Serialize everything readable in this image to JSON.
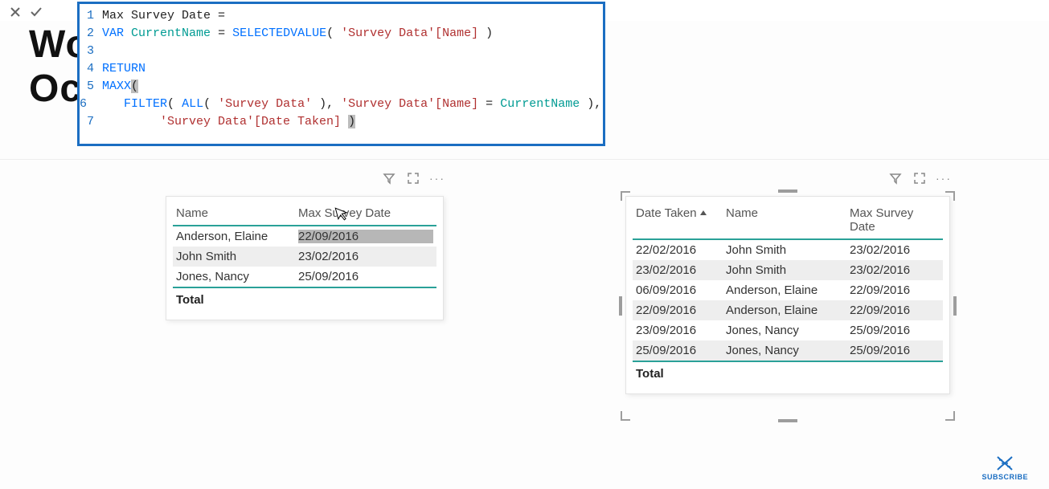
{
  "bg_text": {
    "line1": "Wo",
    "line2": "Oc"
  },
  "formula": {
    "lines": [
      {
        "n": "1",
        "seg": [
          {
            "t": "Max Survey Date ="
          }
        ]
      },
      {
        "n": "2",
        "seg": [
          {
            "t": "VAR",
            "c": "kw-blue"
          },
          {
            "t": " "
          },
          {
            "t": "CurrentName",
            "c": "kw-teal"
          },
          {
            "t": " = "
          },
          {
            "t": "SELECTEDVALUE",
            "c": "kw-blue"
          },
          {
            "t": "( "
          },
          {
            "t": "'Survey Data'[Name]",
            "c": "str"
          },
          {
            "t": " )"
          }
        ]
      },
      {
        "n": "3",
        "seg": [
          {
            "t": ""
          }
        ]
      },
      {
        "n": "4",
        "seg": [
          {
            "t": "RETURN",
            "c": "kw-blue"
          }
        ]
      },
      {
        "n": "5",
        "seg": [
          {
            "t": "MAXX",
            "c": "kw-blue"
          },
          {
            "t": "(",
            "c": "paren-y"
          }
        ]
      },
      {
        "n": "6",
        "seg": [
          {
            "t": "    "
          },
          {
            "t": "FILTER",
            "c": "kw-blue"
          },
          {
            "t": "( "
          },
          {
            "t": "ALL",
            "c": "kw-blue"
          },
          {
            "t": "( "
          },
          {
            "t": "'Survey Data'",
            "c": "str"
          },
          {
            "t": " ), "
          },
          {
            "t": "'Survey Data'[Name]",
            "c": "str"
          },
          {
            "t": " = "
          },
          {
            "t": "CurrentName",
            "c": "kw-teal"
          },
          {
            "t": " ),"
          }
        ]
      },
      {
        "n": "7",
        "seg": [
          {
            "t": "        "
          },
          {
            "t": "'Survey Data'[Date Taken]",
            "c": "str"
          },
          {
            "t": " "
          },
          {
            "t": ")",
            "c": "paren-y"
          }
        ]
      }
    ]
  },
  "vis1": {
    "headers": [
      "Name",
      "Max Survey Date"
    ],
    "rows": [
      {
        "cells": [
          "Anderson, Elaine",
          "22/09/2016"
        ],
        "sel": true
      },
      {
        "cells": [
          "John Smith",
          "23/02/2016"
        ],
        "alt": true
      },
      {
        "cells": [
          "Jones, Nancy",
          "25/09/2016"
        ]
      }
    ],
    "total": "Total"
  },
  "vis2": {
    "headers": [
      "Date Taken",
      "Name",
      "Max Survey Date"
    ],
    "sort_col": 0,
    "rows": [
      {
        "cells": [
          "22/02/2016",
          "John Smith",
          "23/02/2016"
        ]
      },
      {
        "cells": [
          "23/02/2016",
          "John Smith",
          "23/02/2016"
        ],
        "alt": true
      },
      {
        "cells": [
          "06/09/2016",
          "Anderson, Elaine",
          "22/09/2016"
        ]
      },
      {
        "cells": [
          "22/09/2016",
          "Anderson, Elaine",
          "22/09/2016"
        ],
        "alt": true
      },
      {
        "cells": [
          "23/09/2016",
          "Jones, Nancy",
          "25/09/2016"
        ]
      },
      {
        "cells": [
          "25/09/2016",
          "Jones, Nancy",
          "25/09/2016"
        ],
        "alt": true
      }
    ],
    "total": "Total"
  },
  "subscribe": "SUBSCRIBE"
}
